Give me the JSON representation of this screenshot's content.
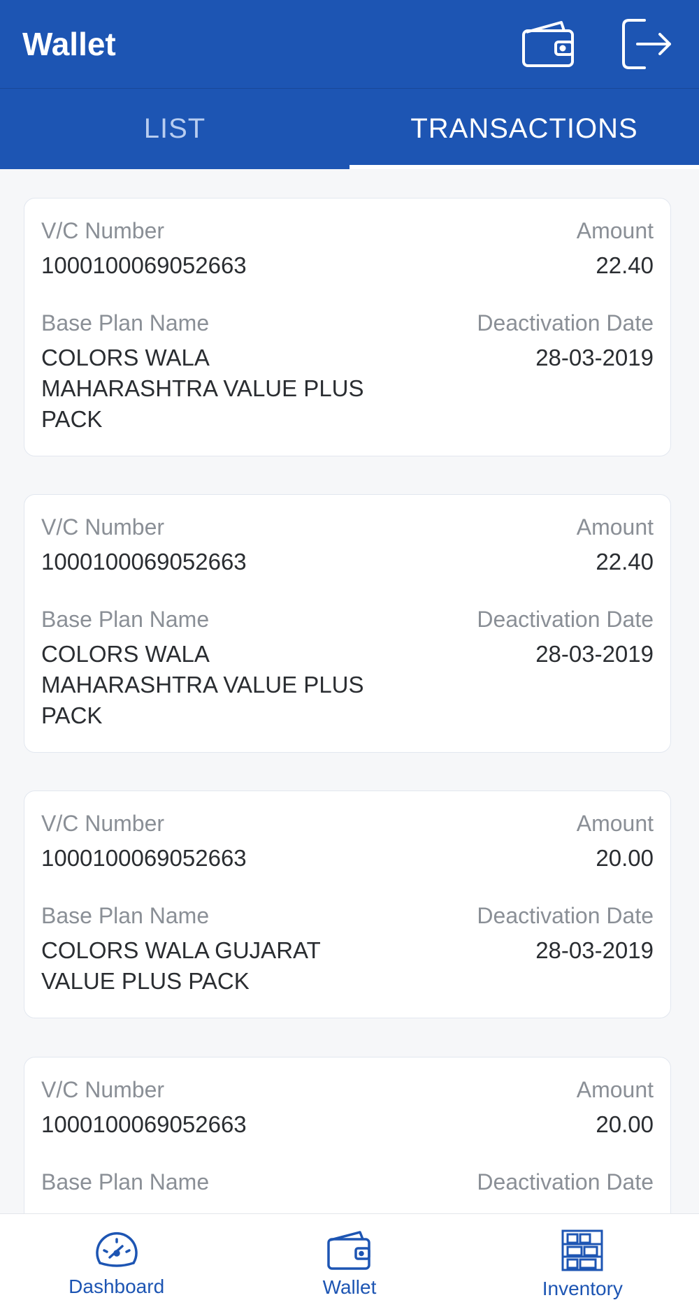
{
  "header": {
    "title": "Wallet",
    "actions": [
      {
        "icon": "wallet-icon"
      },
      {
        "icon": "logout-icon"
      }
    ]
  },
  "tabs": [
    {
      "label": "LIST",
      "active": false
    },
    {
      "label": "TRANSACTIONS",
      "active": true
    }
  ],
  "transactions": [
    {
      "vc_label": "V/C Number",
      "vc": "1000100069052663",
      "amount_label": "Amount",
      "amount": "22.40",
      "plan_label": "Base Plan Name",
      "plan": "COLORS WALA MAHARASHTRA VALUE PLUS PACK",
      "date_label": "Deactivation Date",
      "date": "28-03-2019"
    },
    {
      "vc_label": "V/C Number",
      "vc": "1000100069052663",
      "amount_label": "Amount",
      "amount": "22.40",
      "plan_label": "Base Plan Name",
      "plan": "COLORS WALA MAHARASHTRA VALUE PLUS PACK",
      "date_label": "Deactivation Date",
      "date": "28-03-2019"
    },
    {
      "vc_label": "V/C Number",
      "vc": "1000100069052663",
      "amount_label": "Amount",
      "amount": "20.00",
      "plan_label": "Base Plan Name",
      "plan": "COLORS WALA GUJARAT VALUE PLUS PACK",
      "date_label": "Deactivation Date",
      "date": "28-03-2019"
    },
    {
      "vc_label": "V/C Number",
      "vc": "1000100069052663",
      "amount_label": "Amount",
      "amount": "20.00",
      "plan_label": "Base Plan Name",
      "date_label": "Deactivation Date"
    }
  ],
  "bottom_nav": [
    {
      "label": "Dashboard",
      "icon": "speedometer-icon"
    },
    {
      "label": "Wallet",
      "icon": "wallet-icon"
    },
    {
      "label": "Inventory",
      "icon": "inventory-icon"
    }
  ],
  "colors": {
    "primary": "#1d55b3",
    "tab_inactive": "#b8cdf0",
    "label_gray": "#8a8f96",
    "text_dark": "#2a2d31"
  }
}
